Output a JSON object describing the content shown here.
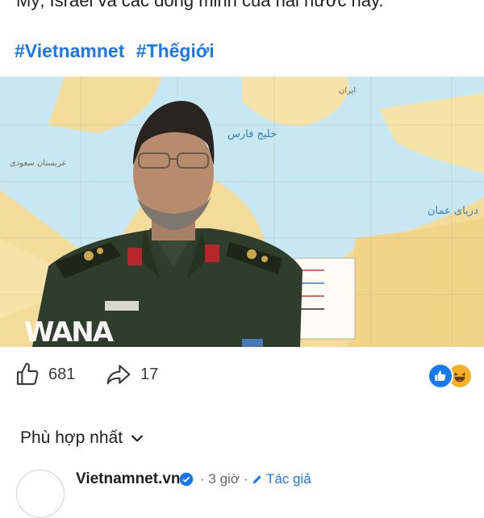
{
  "post": {
    "text_tail": "Mỹ, Israel và các đồng minh của hai nước này.",
    "hashtags": [
      "#Vietnamnet",
      "#Thếgiới"
    ]
  },
  "photo": {
    "watermark": "WANA",
    "map_label_gulf": "خليج فارس",
    "map_label_oman": "درياى عمان",
    "map_label_region": "عربستان سعودى",
    "map_label_iran": "ایران"
  },
  "actions": {
    "like_count": "681",
    "share_count": "17",
    "reaction_icons": [
      "like-reaction",
      "haha-reaction"
    ]
  },
  "comments": {
    "sort_label": "Phù hợp nhất",
    "first": {
      "author": "Vietnamnet.vn",
      "separator": "·",
      "time": "3 giờ",
      "author_badge": "Tác giả"
    }
  },
  "colors": {
    "accent": "#1877f2",
    "text": "#1c1e21",
    "muted": "#65676b",
    "map_sea": "#c7e8f3",
    "map_land": "#f3dc9a"
  }
}
